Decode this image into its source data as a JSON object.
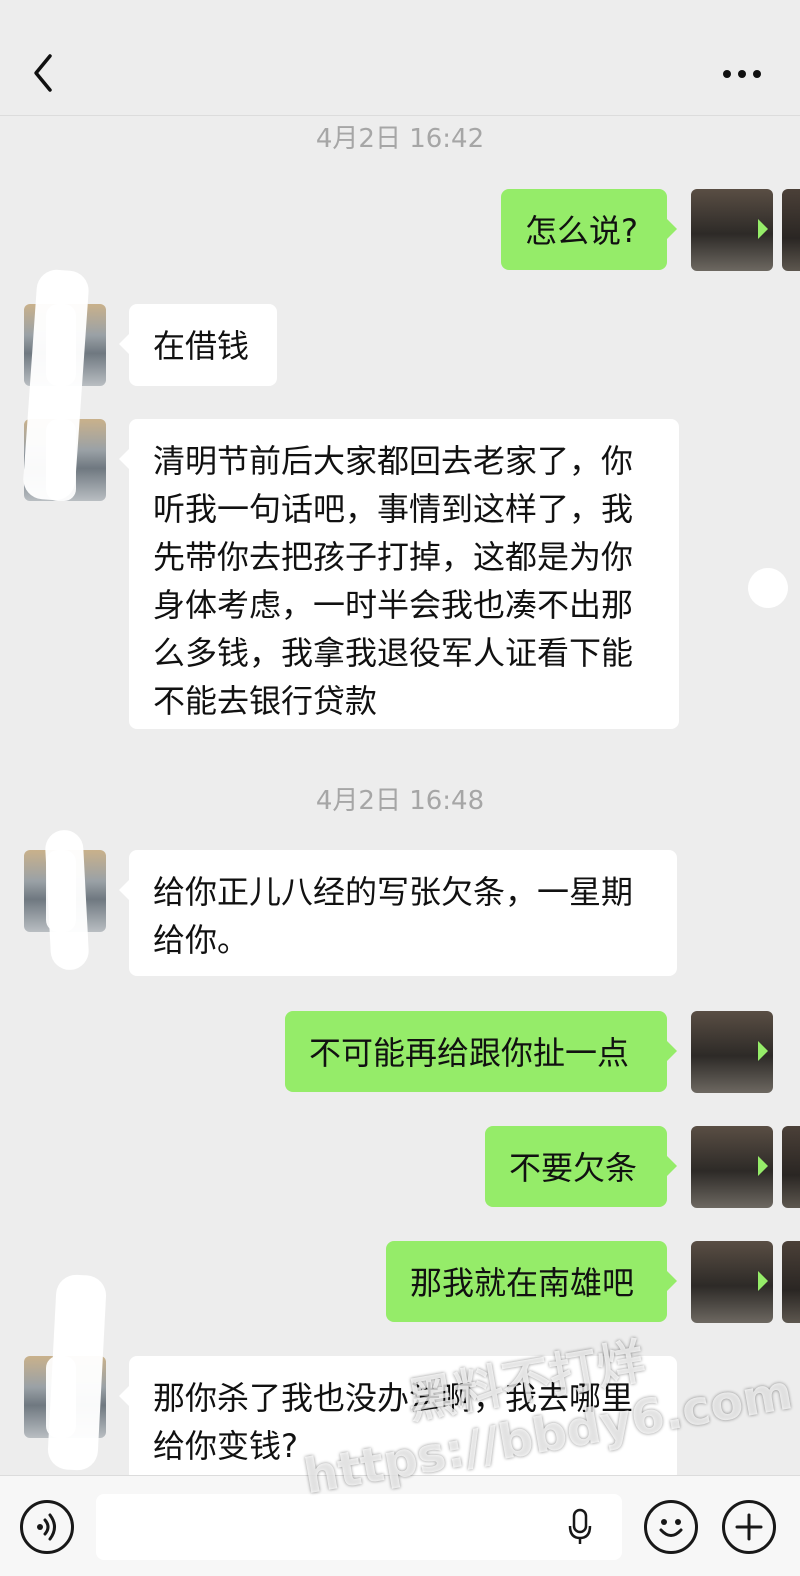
{
  "header": {
    "back_icon": "chevron-left-icon",
    "more_icon": "more-dots-icon"
  },
  "timestamps": [
    "4月2日 16:42",
    "4月2日 16:48"
  ],
  "messages": [
    {
      "side": "out",
      "text": "怎么说?"
    },
    {
      "side": "in",
      "text": "在借钱"
    },
    {
      "side": "in",
      "text": "清明节前后大家都回去老家了，你听我一句话吧，事情到这样了，我先带你去把孩子打掉，这都是为你身体考虑，一时半会我也凑不出那么多钱，我拿我退役军人证看下能不能去银行贷款"
    },
    {
      "side": "in",
      "text": "给你正儿八经的写张欠条，一星期给你。"
    },
    {
      "side": "out",
      "text": "不可能再给跟你扯一点"
    },
    {
      "side": "out",
      "text": "不要欠条"
    },
    {
      "side": "out",
      "text": "那我就在南雄吧"
    },
    {
      "side": "in",
      "text": "那你杀了我也没办法啊，我去哪里给你变钱?"
    }
  ],
  "watermark": {
    "line1": "黑料不打烊",
    "line2": "https://bbdy6.com"
  },
  "input_bar": {
    "voice_icon": "voice-toggle-icon",
    "mic_icon": "microphone-icon",
    "emoji_icon": "emoji-icon",
    "plus_icon": "plus-icon"
  },
  "colors": {
    "background": "#ededed",
    "outgoing_bubble": "#95ec69",
    "incoming_bubble": "#ffffff",
    "timestamp": "#a6a6a6"
  }
}
